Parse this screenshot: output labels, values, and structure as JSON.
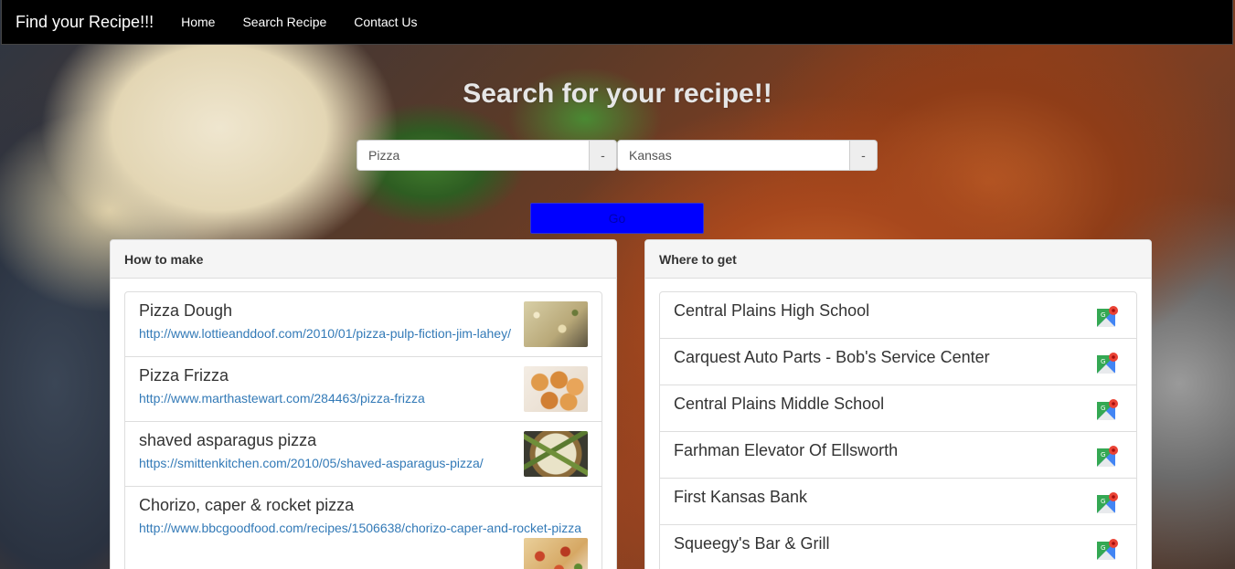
{
  "navbar": {
    "brand": "Find your Recipe!!!",
    "links": [
      "Home",
      "Search Recipe",
      "Contact Us"
    ]
  },
  "hero": {
    "title": "Search for your recipe!!"
  },
  "search": {
    "recipe_value": "Pizza",
    "location_value": "Kansas",
    "addon_symbol": "-",
    "go_label": "Go"
  },
  "how_to_make": {
    "heading": "How to make",
    "items": [
      {
        "title": "Pizza Dough",
        "url": "http://www.lottieanddoof.com/2010/01/pizza-pulp-fiction-jim-lahey/",
        "icon": "pizza-dough-thumbnail"
      },
      {
        "title": "Pizza Frizza",
        "url": "http://www.marthastewart.com/284463/pizza-frizza",
        "icon": "pizza-frizza-thumbnail"
      },
      {
        "title": "shaved asparagus pizza",
        "url": "https://smittenkitchen.com/2010/05/shaved-asparagus-pizza/",
        "icon": "asparagus-pizza-thumbnail"
      },
      {
        "title": "Chorizo, caper & rocket pizza",
        "url": "http://www.bbcgoodfood.com/recipes/1506638/chorizo-caper-and-rocket-pizza",
        "icon": "chorizo-pizza-thumbnail"
      }
    ]
  },
  "where_to_get": {
    "heading": "Where to get",
    "items": [
      {
        "name": "Central Plains High School",
        "icon": "google-maps-icon"
      },
      {
        "name": "Carquest Auto Parts - Bob's Service Center",
        "icon": "google-maps-icon"
      },
      {
        "name": "Central Plains Middle School",
        "icon": "google-maps-icon"
      },
      {
        "name": "Farhman Elevator Of Ellsworth",
        "icon": "google-maps-icon"
      },
      {
        "name": "First Kansas Bank",
        "icon": "google-maps-icon"
      },
      {
        "name": "Squeegy's Bar & Grill",
        "icon": "google-maps-icon"
      }
    ]
  },
  "colors": {
    "navbar_bg": "#000000",
    "go_button_bg": "#0000ff",
    "link": "#337ab7",
    "hero_text": "#e6e6e6"
  }
}
